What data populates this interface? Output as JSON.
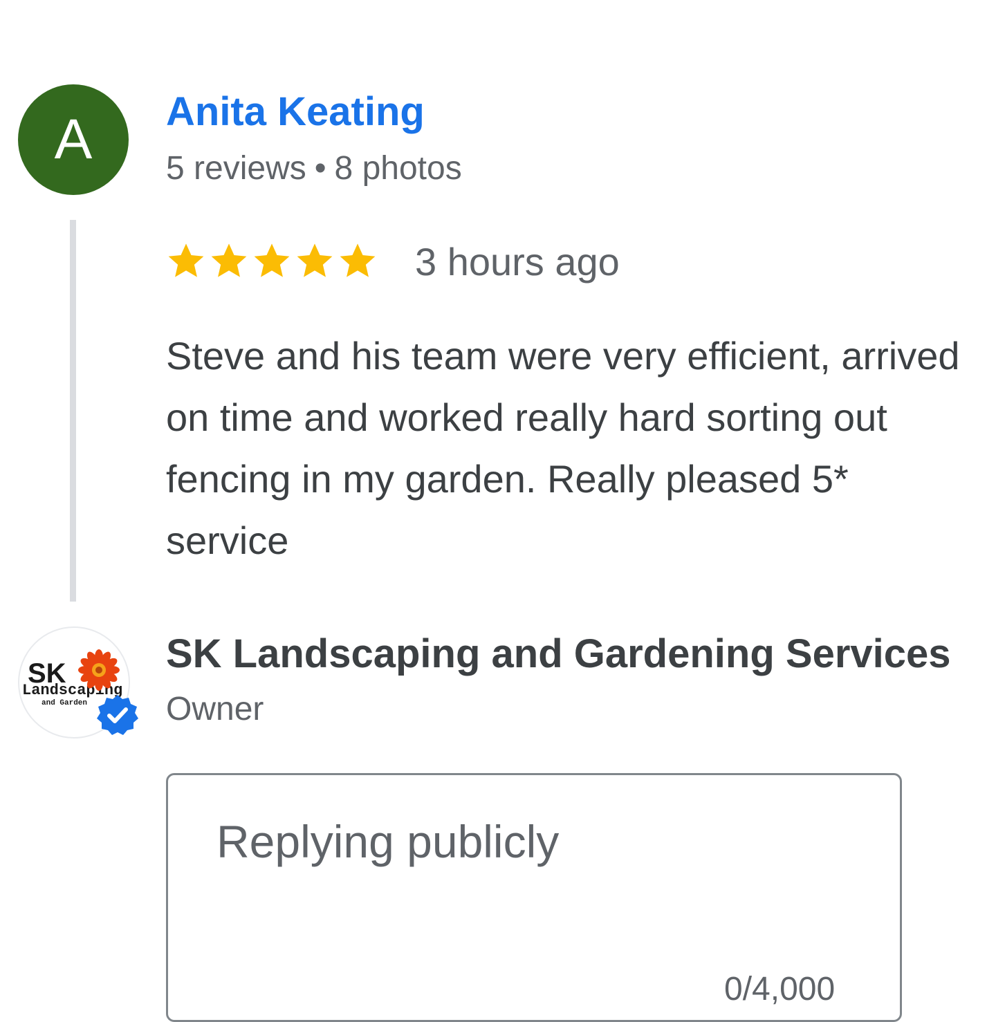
{
  "review": {
    "avatar_initial": "A",
    "avatar_color": "#33691e",
    "reviewer_name": "Anita Keating",
    "reviews_count": "5 reviews",
    "meta_separator": "•",
    "photos_count": "8 photos",
    "rating": 5,
    "max_rating": 5,
    "star_color": "#fbbc04",
    "time_ago": "3 hours ago",
    "text": "Steve and his team were very efficient, arrived on time and worked really hard sorting out fencing in my garden. Really pleased 5* service"
  },
  "owner": {
    "logo_text_main": "SK",
    "logo_text_line2": "Landscaping",
    "logo_text_line3": "and Garden",
    "name": "SK Landscaping and Gardening Services",
    "role": "Owner",
    "verified_badge_color": "#1a73e8"
  },
  "reply": {
    "placeholder": "Replying publicly",
    "char_count": "0/4,000"
  },
  "colors": {
    "link_blue": "#1a73e8",
    "text_primary": "#3c4043",
    "text_secondary": "#5f6368",
    "thread_line": "#dadce0"
  }
}
